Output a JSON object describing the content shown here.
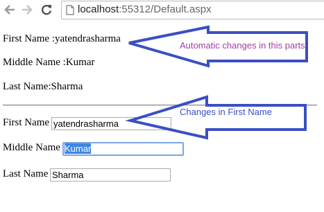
{
  "browser": {
    "url_domain": "localhost",
    "url_rest": ":55312/Default.aspx"
  },
  "display": {
    "first_name_label": "First Name :yatendrasharma",
    "middle_name_label": "Middle Name :Kumar",
    "last_name_label": "Last Name:Sharma"
  },
  "form": {
    "first_name_label": "First Name",
    "first_name_value": "yatendrasharma",
    "middle_name_label": "Middle Name",
    "middle_name_value": "Kumar",
    "last_name_label": "Last Name",
    "last_name_value": "Sharma"
  },
  "annotations": {
    "automatic_note": "Automatic changes in this parts",
    "changes_note": "Changes in First Name",
    "arrow_color": "#3a4fc4",
    "automatic_note_color": "#a040a0",
    "changes_note_color": "#3a4fc4"
  }
}
